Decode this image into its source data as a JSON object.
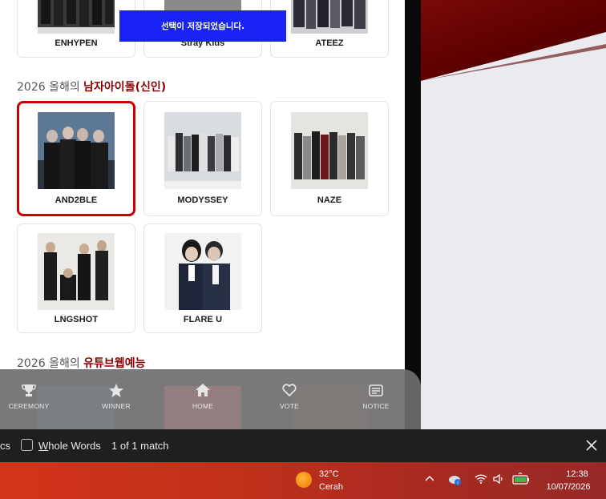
{
  "toast": {
    "message": "선택이 저장되었습니다."
  },
  "top_row": [
    {
      "name": "ENHYPEN"
    },
    {
      "name": "Stray Kids"
    },
    {
      "name": "ATEEZ"
    }
  ],
  "section_rookie": {
    "prefix": "2026 올해의 ",
    "highlight": "남자아이돌(신인)"
  },
  "rookie_cards": [
    {
      "name": "AND2BLE",
      "selected": true
    },
    {
      "name": "MODYSSEY",
      "selected": false
    },
    {
      "name": "NAZE",
      "selected": false
    },
    {
      "name": "LNGSHOT",
      "selected": false
    },
    {
      "name": "FLARE U",
      "selected": false
    }
  ],
  "section_youtube": {
    "prefix": "2026 올해의 ",
    "highlight": "유튜브웹예능"
  },
  "bottom_nav": [
    {
      "label": "CEREMONY",
      "icon": "trophy-icon"
    },
    {
      "label": "WINNER",
      "icon": "star-icon"
    },
    {
      "label": "HOME",
      "icon": "home-icon"
    },
    {
      "label": "VOTE",
      "icon": "heart-icon"
    },
    {
      "label": "NOTICE",
      "icon": "notice-icon"
    }
  ],
  "findbar": {
    "truncated_option": "cs",
    "whole_words_label_ul": "W",
    "whole_words_label_rest": "hole Words",
    "match_count": "1 of 1 match"
  },
  "taskbar": {
    "temperature": "32°C",
    "condition": "Cerah",
    "time": "12:38",
    "date": "10/07/2026"
  },
  "colors": {
    "accent_red": "#8b0000",
    "selected_border": "#c80000",
    "toast_blue": "#1a23f5"
  }
}
